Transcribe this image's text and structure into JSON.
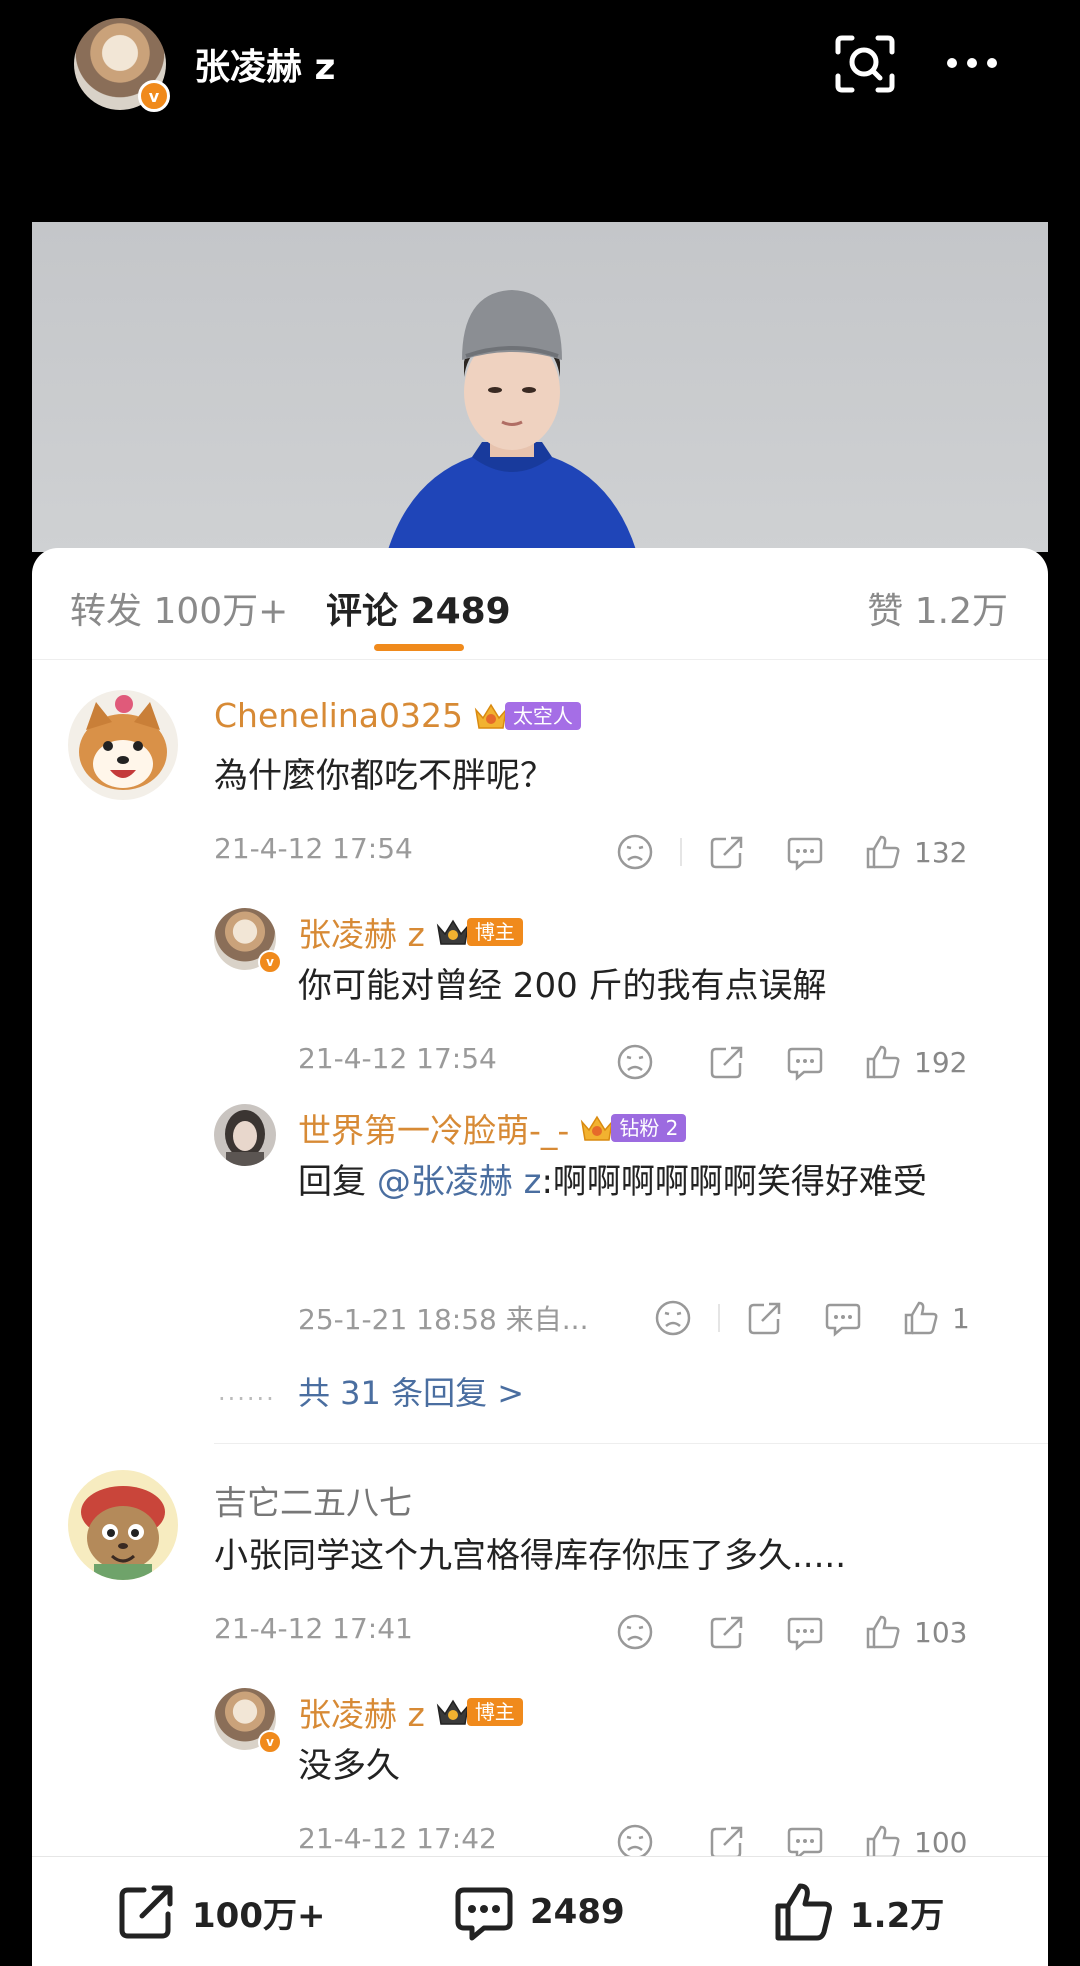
{
  "header": {
    "username": "张凌赫 z",
    "verified_badge": "v",
    "scan_icon": "scan-search-icon",
    "more_icon": "more-icon"
  },
  "tabs": {
    "repost": "转发 100万+",
    "comments": "评论 2489",
    "likes": "赞 1.2万",
    "active_color": "#f08a1c"
  },
  "comments": [
    {
      "name": "Chenelina0325",
      "badge": "太空人",
      "text": "為什麼你都吃不胖呢？",
      "time": "21-4-12 17:54",
      "likes": "132",
      "replies": [
        {
          "name": "张凌赫 z",
          "badge": "博主",
          "text": "你可能对曾经 200 斤的我有点误解",
          "time": "21-4-12 17:54",
          "likes": "192"
        },
        {
          "name": "世界第一冷脸萌-_-",
          "badge": "钻粉 2",
          "reply_prefix": "回复 ",
          "mention": "@张凌赫 z",
          "text": ":啊啊啊啊啊啊笑得好难受",
          "time": "25-1-21 18:58  来自...",
          "likes": "1"
        }
      ],
      "replies_link": "共 31 条回复 >"
    },
    {
      "name": "吉它二五八七",
      "text": "小张同学这个九宫格得库存你压了多久.....",
      "time": "21-4-12 17:41",
      "likes": "103",
      "replies": [
        {
          "name": "张凌赫 z",
          "badge": "博主",
          "text": "没多久",
          "time": "21-4-12 17:42",
          "likes": "100"
        }
      ]
    }
  ],
  "bottom_bar": {
    "repost": "100万+",
    "comment": "2489",
    "like": "1.2万"
  },
  "colors": {
    "name_orange": "#d78a35",
    "link_blue": "#4a6ea0",
    "accent": "#f08a1c"
  }
}
